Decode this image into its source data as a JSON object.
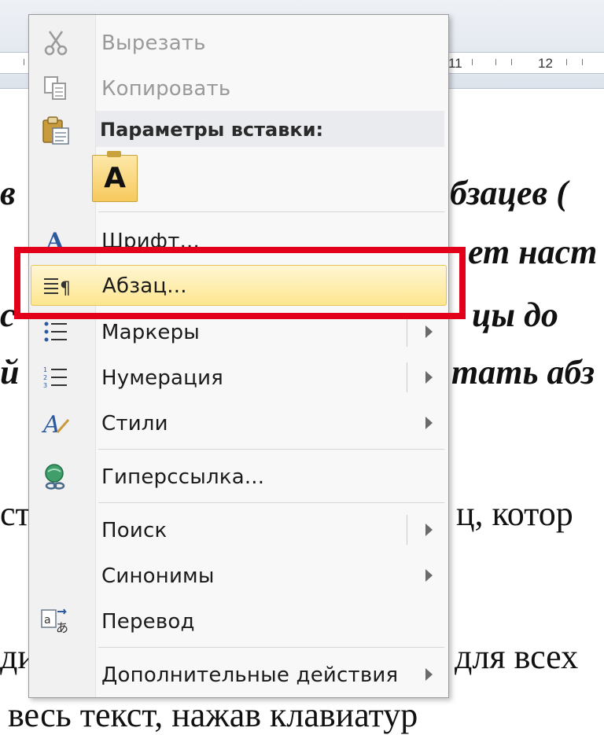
{
  "document": {
    "ruler_numbers": [
      "11",
      "12"
    ],
    "lines": [
      {
        "left_text": "в",
        "right_text": "бзацев  (",
        "italic": true
      },
      {
        "left_text": "",
        "right_text": "ет  наст",
        "italic": true
      },
      {
        "left_text": "с",
        "right_text": "цы  до",
        "italic": true
      },
      {
        "left_text": "й",
        "right_text": "тать  абз",
        "italic": true
      },
      {
        "left_text": "ст",
        "right_text": "ц,  котор",
        "italic": false
      },
      {
        "left_text": "ди",
        "right_text": "для  всех",
        "italic": false
      },
      {
        "left_text": "весь  текст,  нажав  клавиатур",
        "right_text": "",
        "italic": false
      }
    ]
  },
  "menu": {
    "items": [
      {
        "name": "cut",
        "label": "Вырезать",
        "disabled": true,
        "icon": "scissors-icon"
      },
      {
        "name": "copy",
        "label": "Копировать",
        "disabled": true,
        "icon": "copy-icon"
      },
      {
        "name": "font",
        "label": "Шрифт...",
        "disabled": false,
        "icon": "font-icon"
      },
      {
        "name": "paragraph",
        "label": "Абзац...",
        "disabled": false,
        "icon": "paragraph-icon",
        "highlighted": true
      },
      {
        "name": "bullets",
        "label": "Маркеры",
        "disabled": false,
        "icon": "bullets-icon",
        "submenu": true,
        "split": true
      },
      {
        "name": "numbering",
        "label": "Нумерация",
        "disabled": false,
        "icon": "numbering-icon",
        "submenu": true,
        "split": true
      },
      {
        "name": "styles",
        "label": "Стили",
        "disabled": false,
        "icon": "styles-icon",
        "submenu": true
      },
      {
        "name": "hyperlink",
        "label": "Гиперссылка...",
        "disabled": false,
        "icon": "hyperlink-icon"
      },
      {
        "name": "search",
        "label": "Поиск",
        "disabled": false,
        "icon": "",
        "submenu": true,
        "split": true
      },
      {
        "name": "synonyms",
        "label": "Синонимы",
        "disabled": false,
        "icon": "",
        "submenu": true
      },
      {
        "name": "translate",
        "label": "Перевод",
        "disabled": false,
        "icon": "translate-icon"
      },
      {
        "name": "more-actions",
        "label": "Дополнительные действия",
        "disabled": false,
        "icon": "",
        "submenu": true
      }
    ],
    "paste_options_header": "Параметры вставки:",
    "paste_keep_text_only_glyph": "A"
  },
  "colors": {
    "highlight": "#fde68f",
    "annotation_box": "#e3001b"
  }
}
